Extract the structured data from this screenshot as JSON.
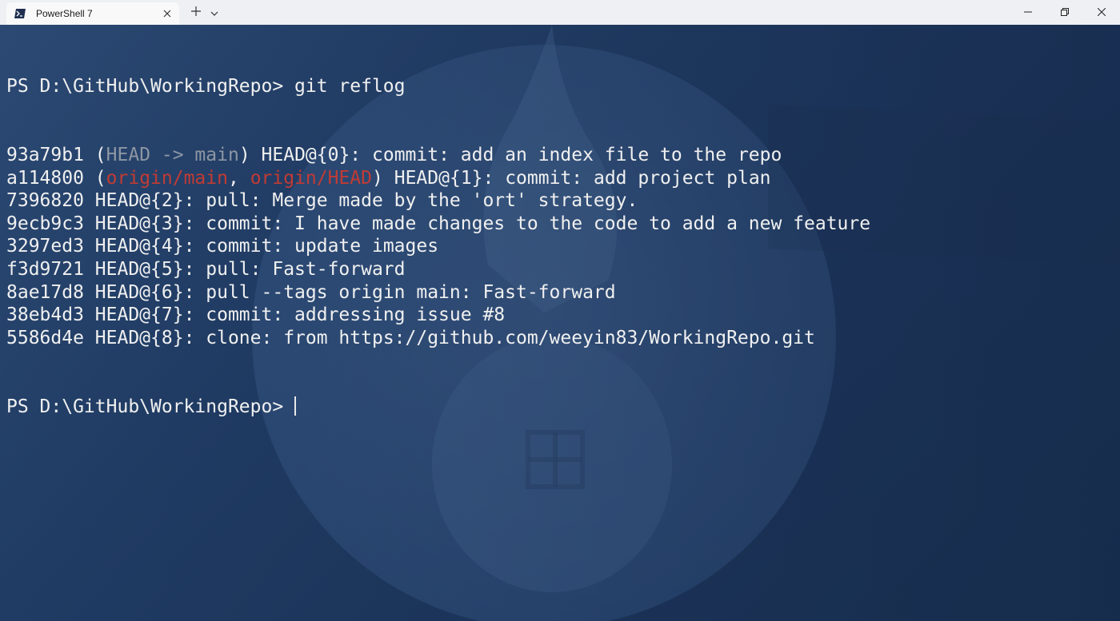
{
  "window": {
    "tab_title": "PowerShell 7",
    "tab_icon": "powershell-icon",
    "new_tab_icon": "plus-icon",
    "dropdown_icon": "chevron-down-icon",
    "controls": [
      "minimize-icon",
      "maximize-icon",
      "close-icon"
    ]
  },
  "colors": {
    "background": "#1d3357",
    "text": "#f0f0f0",
    "muted": "#8d96a3",
    "remote_branch": "#c13b34"
  },
  "terminal": {
    "prompt": "PS D:\\GitHub\\WorkingRepo> ",
    "command": "git reflog",
    "lines": [
      {
        "hash": "93a79b1",
        "refs": [
          {
            "text": "HEAD -> main",
            "style": "gray"
          }
        ],
        "rest": "HEAD@{0}: commit: add an index file to the repo"
      },
      {
        "hash": "a114800",
        "refs": [
          {
            "text": "origin/main",
            "style": "red"
          },
          {
            "text": "origin/HEAD",
            "style": "red"
          }
        ],
        "rest": "HEAD@{1}: commit: add project plan"
      },
      {
        "hash": "7396820",
        "refs": [],
        "rest": "HEAD@{2}: pull: Merge made by the 'ort' strategy."
      },
      {
        "hash": "9ecb9c3",
        "refs": [],
        "rest": "HEAD@{3}: commit: I have made changes to the code to add a new feature"
      },
      {
        "hash": "3297ed3",
        "refs": [],
        "rest": "HEAD@{4}: commit: update images"
      },
      {
        "hash": "f3d9721",
        "refs": [],
        "rest": "HEAD@{5}: pull: Fast-forward"
      },
      {
        "hash": "8ae17d8",
        "refs": [],
        "rest": "HEAD@{6}: pull --tags origin main: Fast-forward"
      },
      {
        "hash": "38eb4d3",
        "refs": [],
        "rest": "HEAD@{7}: commit: addressing issue #8"
      },
      {
        "hash": "5586d4e",
        "refs": [],
        "rest": "HEAD@{8}: clone: from https://github.com/weeyin83/WorkingRepo.git"
      }
    ],
    "final_prompt": "PS D:\\GitHub\\WorkingRepo> "
  }
}
